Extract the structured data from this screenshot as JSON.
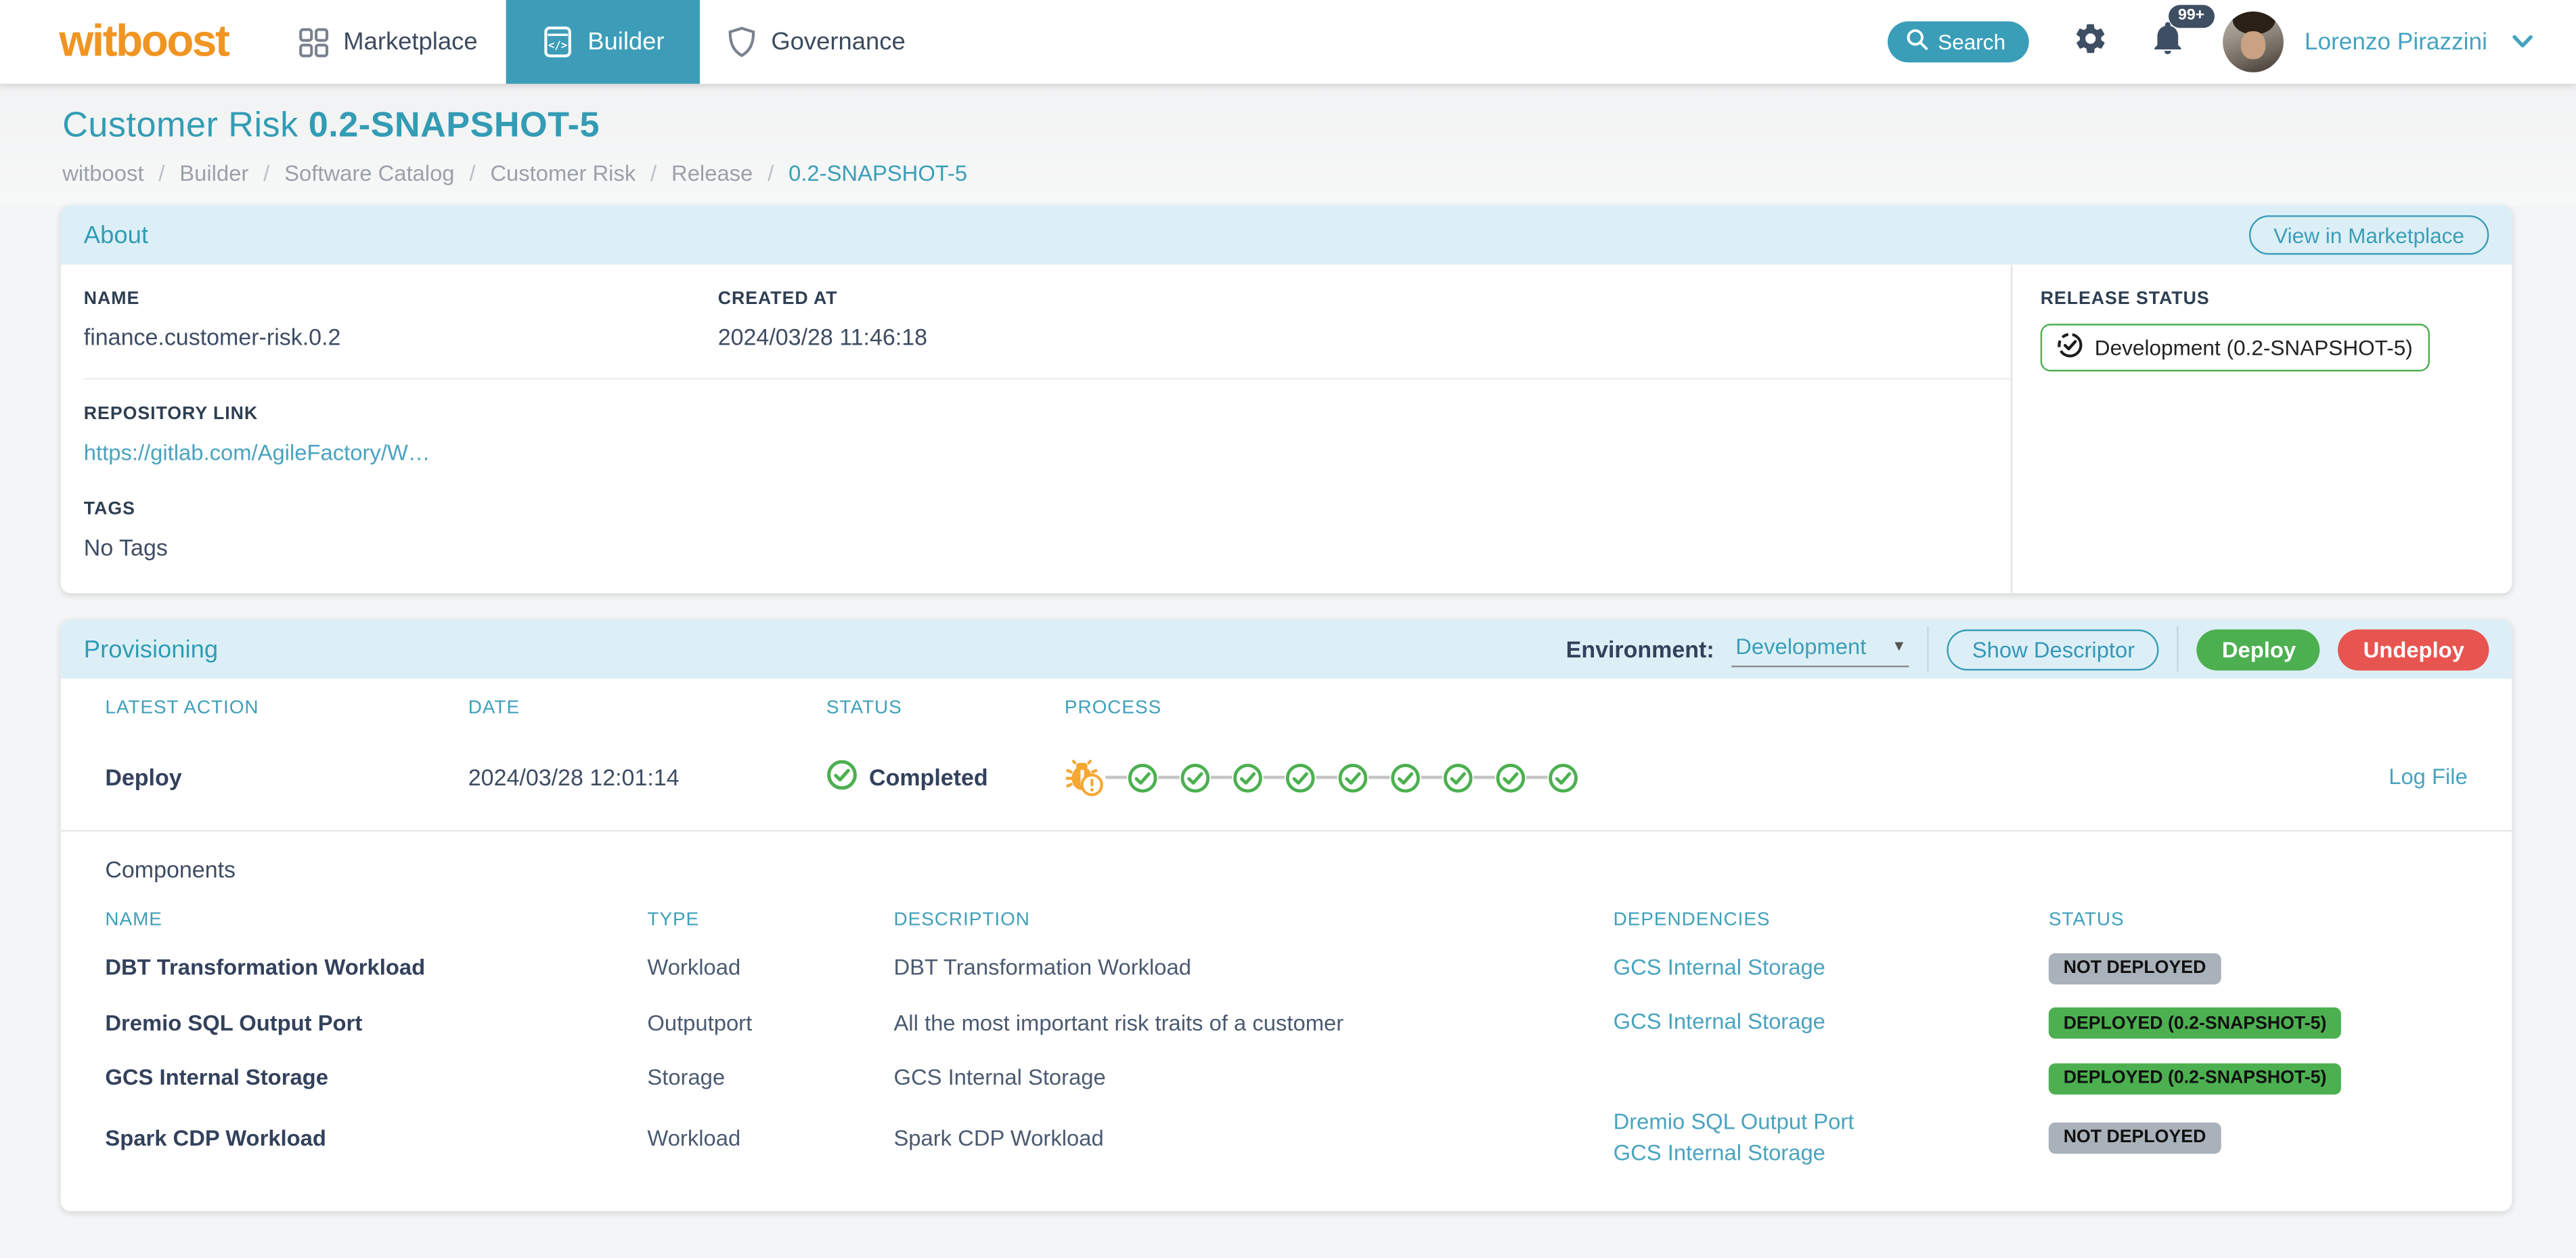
{
  "colors": {
    "accent_teal": "#3a9eb8",
    "navbar_active_bg": "#3d9db8",
    "section_header_bg": "#ddeff6",
    "success_green": "#4cb050",
    "danger_red": "#e85450",
    "logo_orange": "#f09522",
    "process_warning_orange": "#f5a733",
    "badge_gray": "#a9b1ba",
    "dark_text": "#33415c",
    "link_teal": "#49a3c0"
  },
  "navbar": {
    "logo_text": "witboost",
    "items": [
      {
        "label": "Marketplace",
        "icon": "grid-icon",
        "active": false
      },
      {
        "label": "Builder",
        "icon": "code-window-icon",
        "active": true
      },
      {
        "label": "Governance",
        "icon": "shield-icon",
        "active": false
      }
    ],
    "search_label": "Search",
    "notification_badge": "99+",
    "user_name": "Lorenzo Pirazzini"
  },
  "header": {
    "title_prefix": "Customer Risk",
    "title_version": "0.2-SNAPSHOT-5",
    "breadcrumb": [
      "witboost",
      "Builder",
      "Software Catalog",
      "Customer Risk",
      "Release",
      "0.2-SNAPSHOT-5"
    ]
  },
  "about": {
    "section_title": "About",
    "view_in_marketplace_label": "View in Marketplace",
    "name_label": "NAME",
    "name_value": "finance.customer-risk.0.2",
    "created_label": "CREATED AT",
    "created_value": "2024/03/28 11:46:18",
    "repo_label": "REPOSITORY LINK",
    "repo_value": "https://gitlab.com/AgileFactory/W…",
    "tags_label": "TAGS",
    "tags_value": "No Tags",
    "release_label": "RELEASE STATUS",
    "release_value": "Development (0.2-SNAPSHOT-5)"
  },
  "provisioning": {
    "section_title": "Provisioning",
    "environment_label": "Environment:",
    "environment_value": "Development",
    "show_descriptor_label": "Show Descriptor",
    "deploy_label": "Deploy",
    "undeploy_label": "Undeploy",
    "latest": {
      "headers": [
        "LATEST ACTION",
        "DATE",
        "STATUS",
        "PROCESS"
      ],
      "action": "Deploy",
      "date": "2024/03/28 12:01:14",
      "status": "Completed",
      "process_first_step": "warning-bug",
      "process_success_steps": 9,
      "log_file_label": "Log File"
    },
    "components": {
      "title": "Components",
      "headers": [
        "NAME",
        "TYPE",
        "DESCRIPTION",
        "DEPENDENCIES",
        "STATUS"
      ],
      "rows": [
        {
          "name": "DBT Transformation Workload",
          "type": "Workload",
          "description": "DBT Transformation Workload",
          "dependencies": [
            "GCS Internal Storage"
          ],
          "status": {
            "label": "NOT DEPLOYED",
            "kind": "gray"
          }
        },
        {
          "name": "Dremio SQL Output Port",
          "type": "Outputport",
          "description": "All the most important risk traits of a customer",
          "dependencies": [
            "GCS Internal Storage"
          ],
          "status": {
            "label": "DEPLOYED (0.2-SNAPSHOT-5)",
            "kind": "green"
          }
        },
        {
          "name": "GCS Internal Storage",
          "type": "Storage",
          "description": "GCS Internal Storage",
          "dependencies": [],
          "status": {
            "label": "DEPLOYED (0.2-SNAPSHOT-5)",
            "kind": "green"
          }
        },
        {
          "name": "Spark CDP Workload",
          "type": "Workload",
          "description": "Spark CDP Workload",
          "dependencies": [
            "Dremio SQL Output Port",
            "GCS Internal Storage"
          ],
          "status": {
            "label": "NOT DEPLOYED",
            "kind": "gray"
          }
        }
      ]
    }
  }
}
